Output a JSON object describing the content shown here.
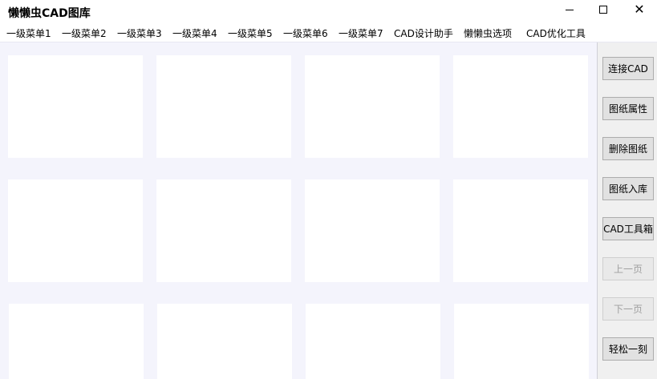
{
  "window": {
    "title": "懒懒虫CAD图库"
  },
  "menu": {
    "items": [
      {
        "label": "一级菜单1"
      },
      {
        "label": "一级菜单2"
      },
      {
        "label": "一级菜单3"
      },
      {
        "label": "一级菜单4"
      },
      {
        "label": "一级菜单5"
      },
      {
        "label": "一级菜单6"
      },
      {
        "label": "一级菜单7"
      },
      {
        "label": "CAD设计助手"
      },
      {
        "label": "懒懒虫选项"
      },
      {
        "label": "CAD优化工具"
      }
    ]
  },
  "sidebar": {
    "buttons": [
      {
        "label": "连接CAD",
        "enabled": true
      },
      {
        "label": "图纸属性",
        "enabled": true
      },
      {
        "label": "删除图纸",
        "enabled": true
      },
      {
        "label": "图纸入库",
        "enabled": true
      },
      {
        "label": "CAD工具箱",
        "enabled": true
      },
      {
        "label": "上一页",
        "enabled": false
      },
      {
        "label": "下一页",
        "enabled": false
      },
      {
        "label": "轻松一刻",
        "enabled": true
      }
    ]
  },
  "colors": {
    "content_bg": "#f4f4fc",
    "tile_bg": "#ffffff",
    "panel_bg": "#f0f0f0",
    "button_bg": "#e1e1e1",
    "disabled_text": "#a0a0a0"
  }
}
